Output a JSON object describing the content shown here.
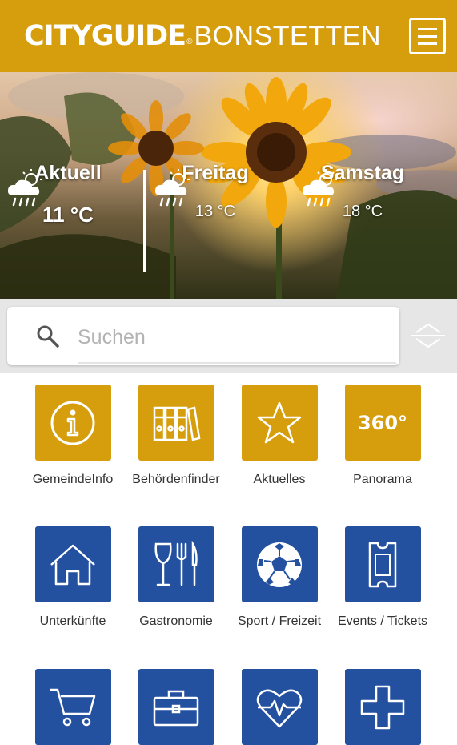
{
  "header": {
    "logo_bold": "CITYGUIDE",
    "logo_reg": "®",
    "logo_city": "BONSTETTEN",
    "menu_icon": "hamburger-menu-icon",
    "color": "#d69d0c"
  },
  "weather": [
    {
      "day": "Aktuell",
      "temp": "11 °C",
      "icon": "cloud-sun-rain-icon"
    },
    {
      "day": "Freitag",
      "temp": "13 °C",
      "icon": "cloud-sun-rain-icon"
    },
    {
      "day": "Samstag",
      "temp": "18 °C",
      "icon": "cloud-sun-rain-icon"
    }
  ],
  "search": {
    "placeholder": "Suchen",
    "icon": "search-icon",
    "sort_icon": "sort-toggle-icon"
  },
  "tiles": [
    {
      "label": "GemeindeInfo",
      "icon": "info-icon",
      "color": "gold"
    },
    {
      "label": "Behördenfinder",
      "icon": "binders-icon",
      "color": "gold"
    },
    {
      "label": "Aktuelles",
      "icon": "star-icon",
      "color": "gold"
    },
    {
      "label": "Panorama",
      "icon": "panorama-360-icon",
      "text": "360°",
      "color": "gold"
    },
    {
      "label": "Unterkünfte",
      "icon": "house-icon",
      "color": "blue"
    },
    {
      "label": "Gastronomie",
      "icon": "wine-cutlery-icon",
      "color": "blue"
    },
    {
      "label": "Sport / Freizeit",
      "icon": "soccer-ball-icon",
      "color": "blue"
    },
    {
      "label": "Events / Tickets",
      "icon": "ticket-icon",
      "color": "blue"
    },
    {
      "label": "",
      "icon": "shopping-cart-icon",
      "color": "blue"
    },
    {
      "label": "",
      "icon": "briefcase-icon",
      "color": "blue"
    },
    {
      "label": "",
      "icon": "heart-pulse-icon",
      "color": "blue"
    },
    {
      "label": "",
      "icon": "medical-cross-icon",
      "color": "blue"
    }
  ],
  "colors": {
    "gold": "#d69d0c",
    "blue": "#2351a0"
  }
}
